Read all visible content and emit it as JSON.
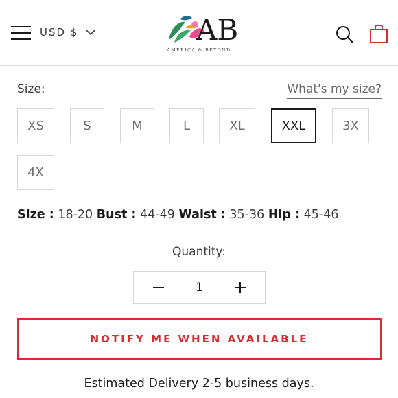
{
  "header": {
    "currency_label": "USD $",
    "logo_monogram": "AB",
    "logo_tagline": "AMERICA & BEYOND"
  },
  "size": {
    "label": "Size:",
    "guide_link": "What's my size?",
    "options": [
      "XS",
      "S",
      "M",
      "L",
      "XL",
      "XXL",
      "3X",
      "4X"
    ],
    "selected": "XXL"
  },
  "measurements": {
    "size_key": "Size :",
    "size_value": "18-20",
    "bust_key": "Bust :",
    "bust_value": "44-49",
    "waist_key": "Waist :",
    "waist_value": "35-36",
    "hip_key": "Hip :",
    "hip_value": "45-46"
  },
  "quantity": {
    "label": "Quantity:",
    "value": "1"
  },
  "notify_button": "NOTIFY ME WHEN AVAILABLE",
  "delivery_text": "Estimated Delivery 2-5 business days.",
  "colors": {
    "accent": "#d42e31",
    "text": "#1c1b1b",
    "border": "#d7d7d7"
  }
}
